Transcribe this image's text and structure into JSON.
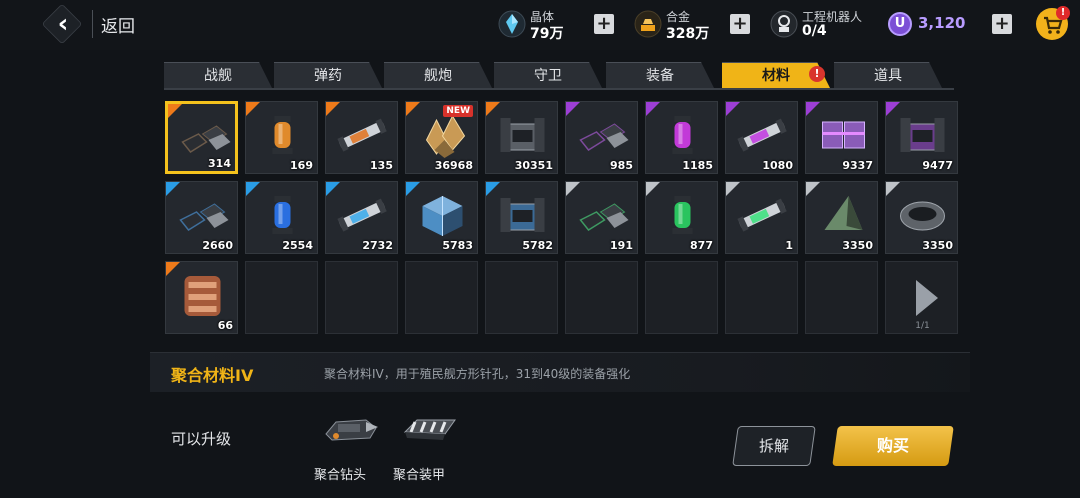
{
  "header": {
    "back_label": "返回"
  },
  "resources": [
    {
      "name": "晶体",
      "value": "79万",
      "icon": "crystal-icon",
      "color": "#5fc9f0"
    },
    {
      "name": "合金",
      "value": "328万",
      "icon": "alloy-icon",
      "color": "#f0a21b"
    },
    {
      "name": "工程机器人",
      "value": "0/4",
      "icon": "robot-icon",
      "color": "#cfd3d8"
    }
  ],
  "premium": {
    "symbol": "U",
    "value": "3,120",
    "color": "#b89cff"
  },
  "cart": {
    "badge": "!"
  },
  "tabs": [
    {
      "label": "战舰"
    },
    {
      "label": "弹药"
    },
    {
      "label": "舰炮"
    },
    {
      "label": "守卫"
    },
    {
      "label": "装备"
    },
    {
      "label": "材料",
      "active": true,
      "badge": "!"
    },
    {
      "label": "道具"
    }
  ],
  "rarity_colors": {
    "orange": "#ee7a1a",
    "purple": "#9d3fd6",
    "blue": "#2a9de6",
    "white": "#bfc3c8"
  },
  "items": [
    {
      "qty": "314",
      "rarity": "orange",
      "kind": "plates-icon",
      "tint": "#6b5a4a",
      "selected": true
    },
    {
      "qty": "169",
      "rarity": "orange",
      "kind": "capsule-icon",
      "tint": "#e08a2c"
    },
    {
      "qty": "135",
      "rarity": "orange",
      "kind": "tube-icon",
      "tint": "#e0813a"
    },
    {
      "qty": "36968",
      "rarity": "orange",
      "kind": "crystals-icon",
      "tint": "#c99a55",
      "new": "NEW"
    },
    {
      "qty": "30351",
      "rarity": "orange",
      "kind": "generator-icon",
      "tint": "#5a5f66"
    },
    {
      "qty": "985",
      "rarity": "purple",
      "kind": "plates-icon",
      "tint": "#7d4a9c"
    },
    {
      "qty": "1185",
      "rarity": "purple",
      "kind": "capsule-icon",
      "tint": "#c23ad8"
    },
    {
      "qty": "1080",
      "rarity": "purple",
      "kind": "tube-icon",
      "tint": "#c44fe0"
    },
    {
      "qty": "9337",
      "rarity": "purple",
      "kind": "blocks-icon",
      "tint": "#8a5cb8"
    },
    {
      "qty": "9477",
      "rarity": "purple",
      "kind": "generator-icon",
      "tint": "#6a3d8c"
    },
    {
      "qty": "2660",
      "rarity": "blue",
      "kind": "plates-icon",
      "tint": "#3f6f9c"
    },
    {
      "qty": "2554",
      "rarity": "blue",
      "kind": "capsule-icon",
      "tint": "#2a6fe0"
    },
    {
      "qty": "2732",
      "rarity": "blue",
      "kind": "tube-icon",
      "tint": "#4fb1ea"
    },
    {
      "qty": "5783",
      "rarity": "blue",
      "kind": "cube-icon",
      "tint": "#4d8ec4"
    },
    {
      "qty": "5782",
      "rarity": "blue",
      "kind": "generator-icon",
      "tint": "#3b6a96"
    },
    {
      "qty": "191",
      "rarity": "white",
      "kind": "plates-icon",
      "tint": "#3e9a62"
    },
    {
      "qty": "877",
      "rarity": "white",
      "kind": "capsule-icon",
      "tint": "#2ac45f"
    },
    {
      "qty": "1",
      "rarity": "white",
      "kind": "tube-icon",
      "tint": "#4fe08a"
    },
    {
      "qty": "3350",
      "rarity": "white",
      "kind": "pyramid-icon",
      "tint": "#6a8a6a"
    },
    {
      "qty": "3350",
      "rarity": "white",
      "kind": "ring-icon",
      "tint": "#5e6369"
    },
    {
      "qty": "66",
      "rarity": "orange",
      "kind": "bundle-icon",
      "tint": "#a65a3a"
    }
  ],
  "pager": {
    "text": "1/1"
  },
  "detail": {
    "title": "聚合材料IV",
    "description": "聚合材料IV，用于殖民舰方形针孔，31到40级的装备强化"
  },
  "upgrade": {
    "label": "可以升级",
    "items": [
      {
        "name": "聚合钻头",
        "icon": "drill-icon"
      },
      {
        "name": "聚合装甲",
        "icon": "armor-icon"
      }
    ]
  },
  "actions": {
    "dismantle": "拆解",
    "buy": "购买"
  }
}
